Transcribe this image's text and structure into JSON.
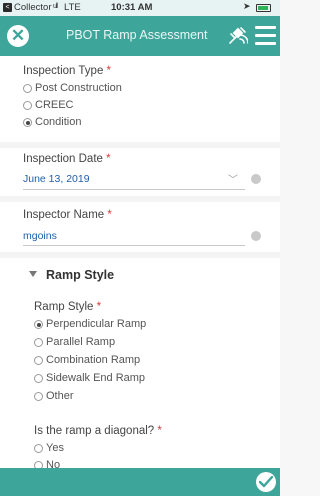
{
  "status_bar": {
    "back_app": "Collector",
    "signal": "ull",
    "carrier": "LTE",
    "time": "10:31 AM"
  },
  "header": {
    "title": "PBOT Ramp Assessment"
  },
  "inspection_type": {
    "label": "Inspection Type",
    "required_mark": "*",
    "options": [
      "Post Construction",
      "CREEC",
      "Condition"
    ],
    "selected": "Condition"
  },
  "inspection_date": {
    "label": "Inspection Date",
    "required_mark": "*",
    "value": "June 13, 2019"
  },
  "inspector_name": {
    "label": "Inspector Name",
    "required_mark": "*",
    "value": "mgoins"
  },
  "ramp_style_group": {
    "heading": "Ramp Style",
    "field_label": "Ramp Style",
    "required_mark": "*",
    "options": [
      "Perpendicular Ramp",
      "Parallel Ramp",
      "Combination Ramp",
      "Sidewalk End Ramp",
      "Other"
    ],
    "selected": "Perpendicular Ramp"
  },
  "diagonal": {
    "label": "Is the ramp a diagonal?",
    "required_mark": "*",
    "options": [
      "Yes",
      "No"
    ]
  },
  "colors": {
    "accent": "#3ea59b",
    "link_value": "#1f5fae",
    "required": "#d43a3a"
  }
}
